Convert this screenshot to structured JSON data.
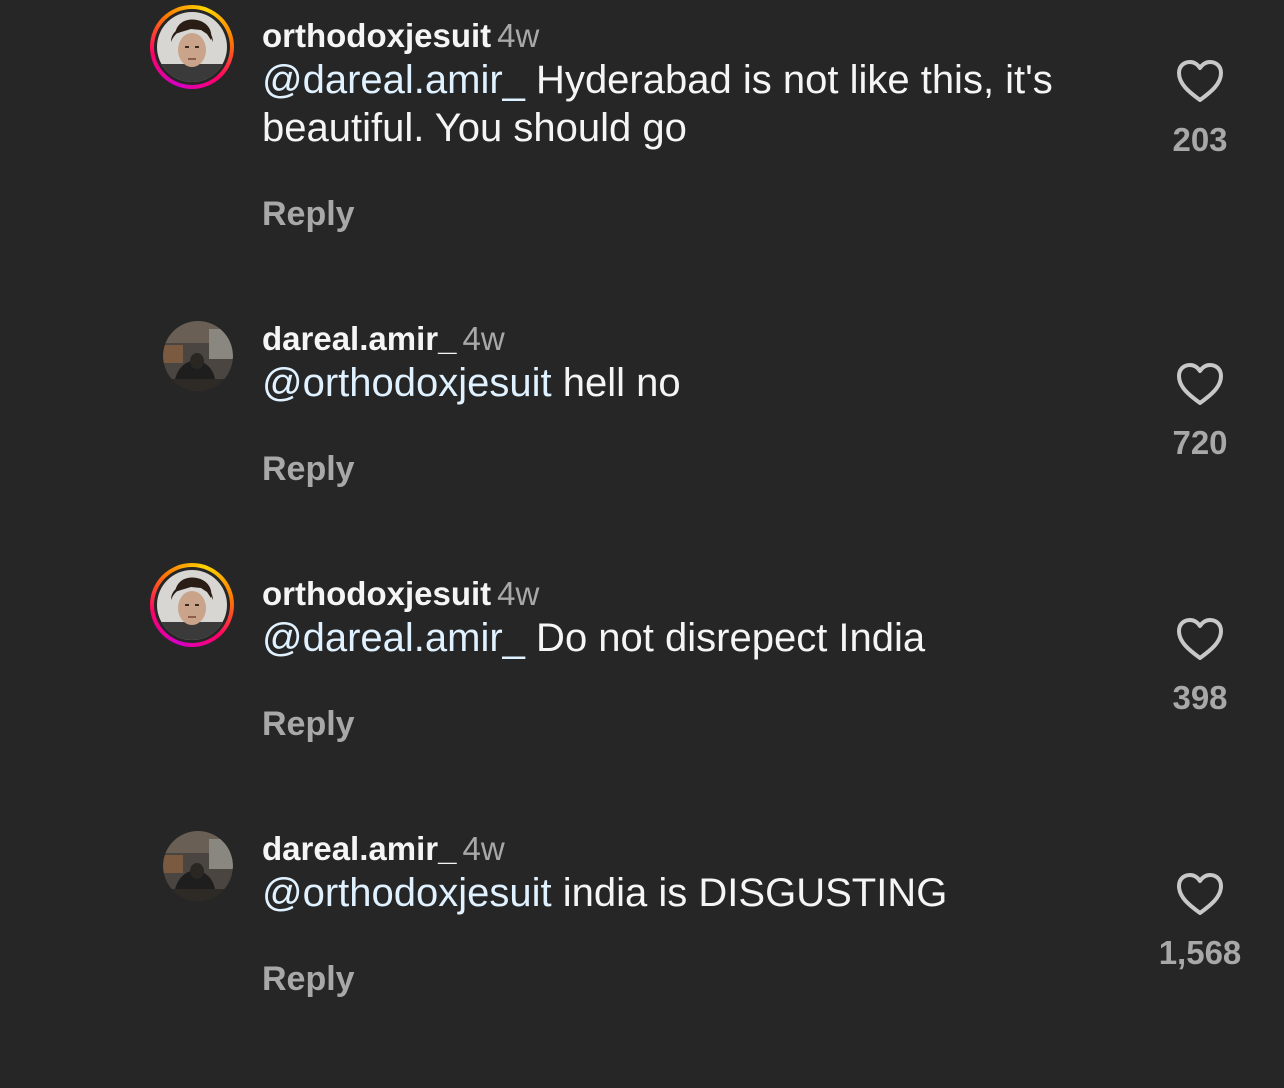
{
  "comments": [
    {
      "username": "orthodoxjesuit",
      "time": "4w",
      "mention": "@dareal.amir_",
      "text": " Hyderabad is not like this, it's beautiful. You should go",
      "reply_label": "Reply",
      "likes": "203",
      "avatar": "orthodoxjesuit-avatar-with-story-ring"
    },
    {
      "username": "dareal.amir_",
      "time": "4w",
      "mention": "@orthodoxjesuit",
      "text": " hell no",
      "reply_label": "Reply",
      "likes": "720",
      "avatar": "dareal-amir-avatar"
    },
    {
      "username": "orthodoxjesuit",
      "time": "4w",
      "mention": "@dareal.amir_",
      "text": " Do not disrepect India",
      "reply_label": "Reply",
      "likes": "398",
      "avatar": "orthodoxjesuit-avatar-with-story-ring"
    },
    {
      "username": "dareal.amir_",
      "time": "4w",
      "mention": "@orthodoxjesuit",
      "text": " india is DISGUSTING",
      "reply_label": "Reply",
      "likes": "1,568",
      "avatar": "dareal-amir-avatar"
    }
  ],
  "icons": {
    "like": "heart-outline-icon"
  },
  "colors": {
    "background": "#262626",
    "primary_text": "#f5f5f5",
    "secondary_text": "#a8a8a8",
    "mention": "#e0f1ff"
  }
}
